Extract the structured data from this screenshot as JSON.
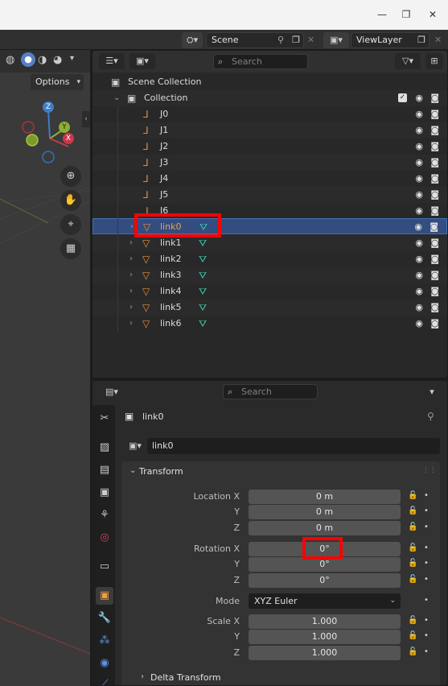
{
  "window": {
    "minimize": "—",
    "restore": "❐",
    "close": "✕"
  },
  "topbar": {
    "scene_label": "Scene",
    "viewlayer_label": "ViewLayer"
  },
  "viewport": {
    "options_label": "Options",
    "axis_x": "X",
    "axis_y": "Y",
    "axis_z": "Z"
  },
  "outliner": {
    "search_placeholder": "Search",
    "scene_collection": "Scene Collection",
    "collection": "Collection",
    "joints": [
      "J0",
      "J1",
      "J2",
      "J3",
      "J4",
      "J5",
      "J6"
    ],
    "links": [
      "link0",
      "link1",
      "link2",
      "link3",
      "link4",
      "link5",
      "link6"
    ],
    "selected": "link0"
  },
  "properties": {
    "search_placeholder": "Search",
    "object_name": "link0",
    "datablock_name": "link0",
    "transform_title": "Transform",
    "location_label": "Location X",
    "rotation_label": "Rotation X",
    "scale_label": "Scale X",
    "y_label": "Y",
    "z_label": "Z",
    "location": [
      "0 m",
      "0 m",
      "0 m"
    ],
    "rotation": [
      "0°",
      "0°",
      "0°"
    ],
    "mode_label": "Mode",
    "mode_value": "XYZ Euler",
    "scale": [
      "1.000",
      "1.000",
      "1.000"
    ],
    "delta_transform": "Delta Transform"
  },
  "colors": {
    "selection": "#334d80",
    "highlight": "#ff0000",
    "object_orange": "#e8903d",
    "mesh_teal": "#3fc1a8"
  }
}
